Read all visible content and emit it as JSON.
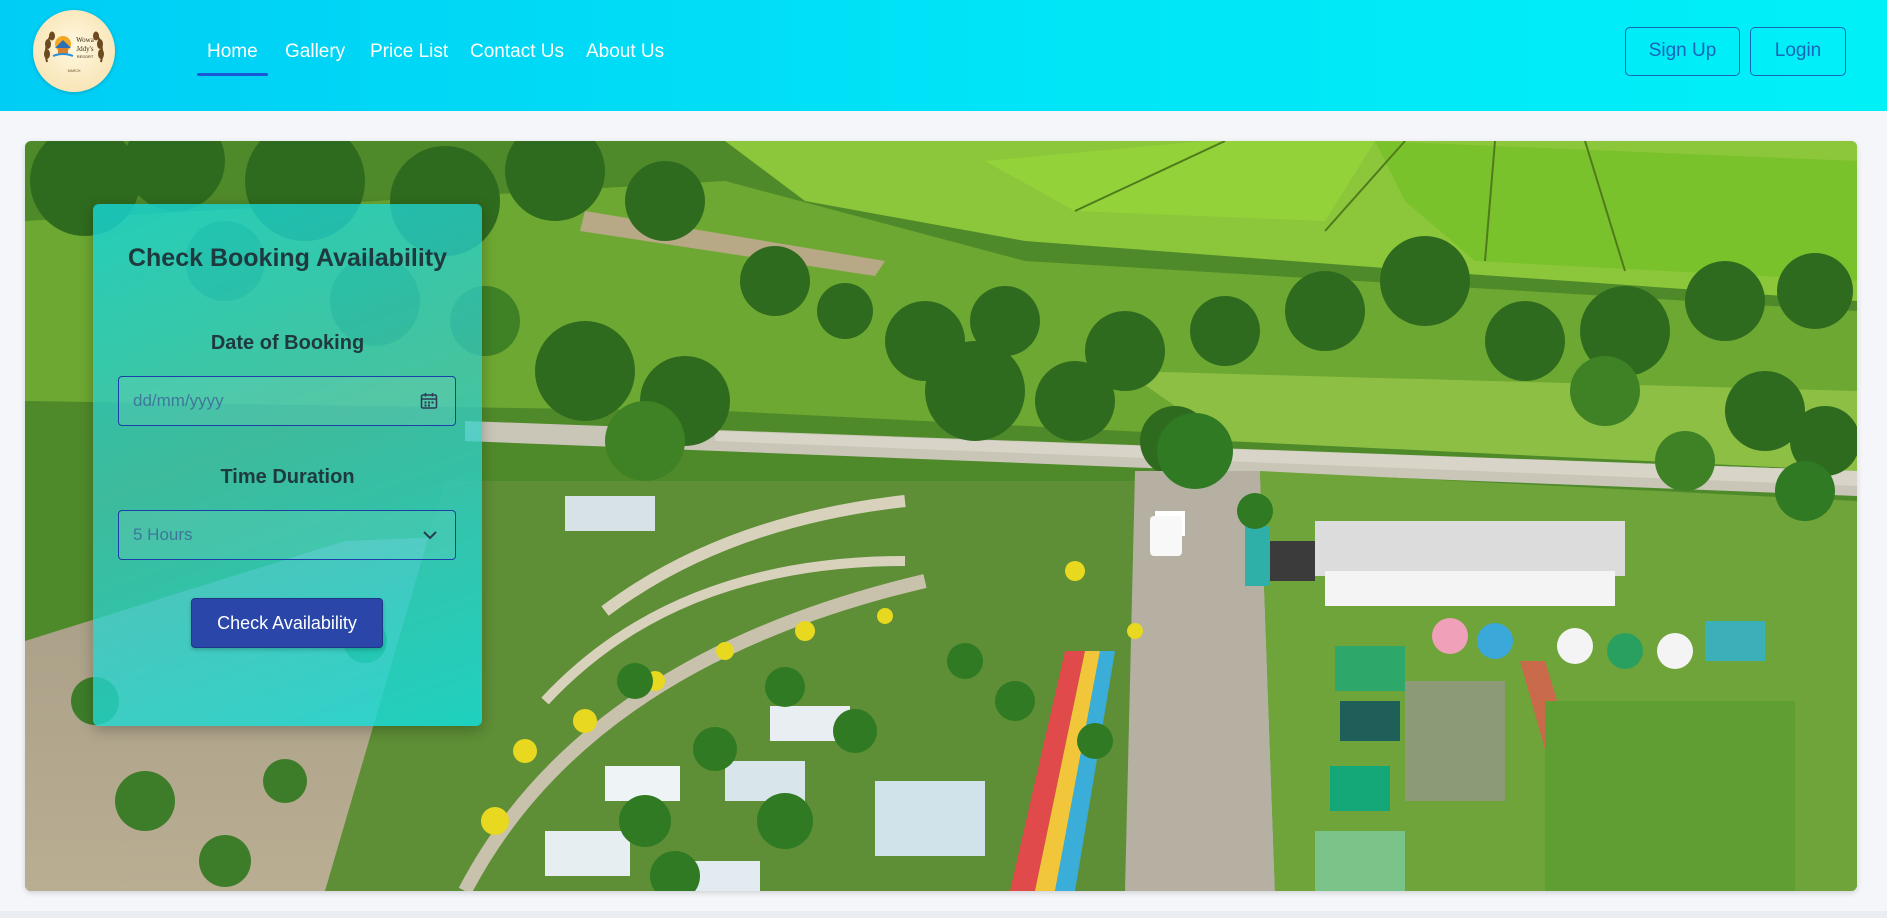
{
  "header": {
    "logo": {
      "icon": "resort-logo-icon",
      "text_line1": "Wowa",
      "text_line2": "Jddy's",
      "text_line3": "RESORT",
      "text_line4": "MARCH"
    },
    "nav": [
      {
        "label": "Home",
        "active": true
      },
      {
        "label": "Gallery",
        "active": false
      },
      {
        "label": "Price List",
        "active": false
      },
      {
        "label": "Contact Us",
        "active": false
      },
      {
        "label": "About Us",
        "active": false
      }
    ],
    "signup_label": "Sign Up",
    "login_label": "Login"
  },
  "booking": {
    "title": "Check Booking Availability",
    "date_label": "Date of Booking",
    "date_placeholder": "dd/mm/yyyy",
    "date_icon": "calendar-icon",
    "duration_label": "Time Duration",
    "duration_value": "5 Hours",
    "duration_icon": "chevron-down-icon",
    "button_label": "Check Availability"
  },
  "colors": {
    "header_gradient_start": "#00cdf5",
    "header_gradient_end": "#00f0f8",
    "nav_active_underline": "#1a58d8",
    "auth_button": "#1766b8",
    "primary_button": "#2946a8",
    "panel_tint": "#14d6d6"
  }
}
